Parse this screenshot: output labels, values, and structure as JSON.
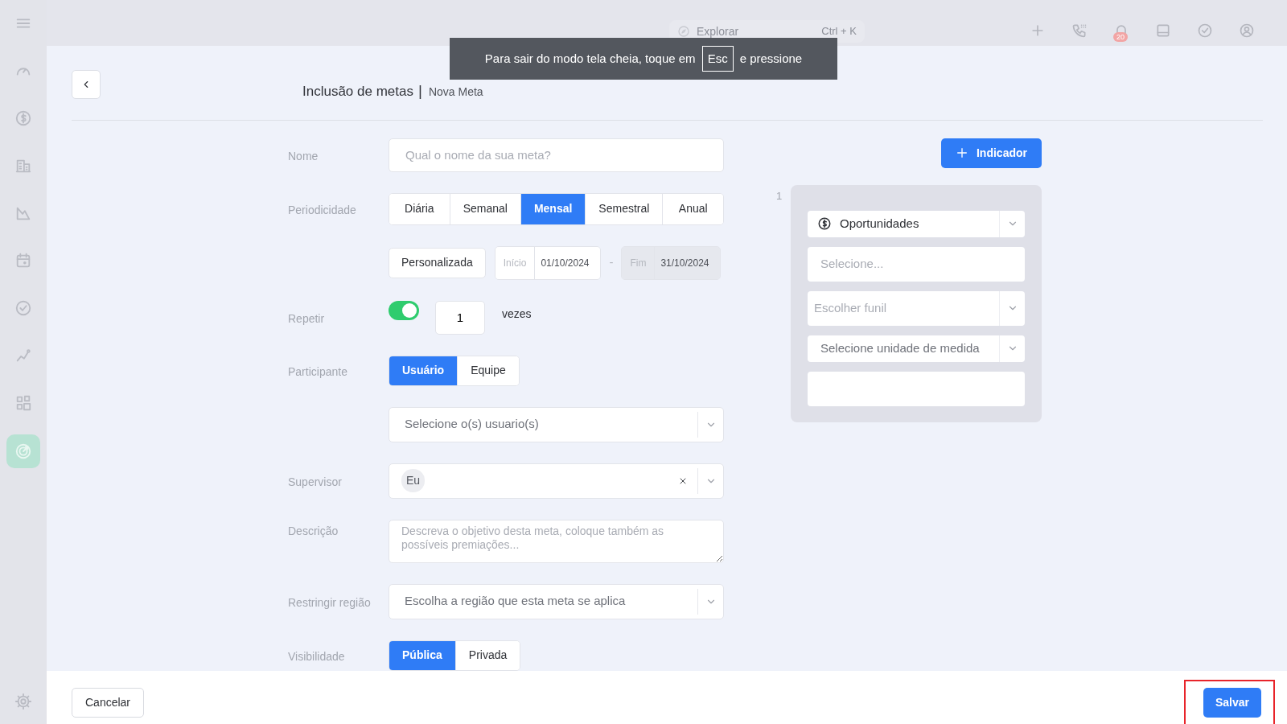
{
  "sidebar": {
    "items": [
      {
        "kind": "menu",
        "selected": false
      },
      {
        "kind": "gauge",
        "selected": false
      },
      {
        "kind": "dollar",
        "selected": false
      },
      {
        "kind": "building",
        "selected": false
      },
      {
        "kind": "chart",
        "selected": false
      },
      {
        "kind": "calendar",
        "selected": false
      },
      {
        "kind": "check",
        "selected": false
      },
      {
        "kind": "trend",
        "selected": false
      },
      {
        "kind": "widgets",
        "selected": false
      },
      {
        "kind": "target",
        "selected": true
      },
      {
        "kind": "settings",
        "selected": false
      }
    ]
  },
  "topbar": {
    "search": {
      "placeholder": "Explorar",
      "shortcut": "Ctrl + K"
    },
    "actions": [
      {
        "kind": "add"
      },
      {
        "kind": "phone"
      },
      {
        "kind": "bell",
        "badge": "20"
      },
      {
        "kind": "inbox"
      },
      {
        "kind": "task"
      },
      {
        "kind": "account"
      }
    ]
  },
  "fullscreen_notice": {
    "before": "Para sair do modo tela cheia, toque em",
    "key": "Esc",
    "after": "e pressione"
  },
  "header": {
    "title": "Inclusão de metas",
    "separator": "|",
    "subtitle": "Nova Meta"
  },
  "form": {
    "name": {
      "label": "Nome",
      "placeholder": "Qual o nome da sua meta?"
    },
    "periodicity": {
      "label": "Periodicidade",
      "options": [
        {
          "label": "Diária",
          "selected": false
        },
        {
          "label": "Semanal",
          "selected": false
        },
        {
          "label": "Mensal",
          "selected": true
        },
        {
          "label": "Semestral",
          "selected": false
        },
        {
          "label": "Anual",
          "selected": false
        }
      ],
      "custom": {
        "label": "Personalizada",
        "selected": false
      },
      "start": {
        "label": "Início",
        "value": "01/10/2024",
        "disabled": false
      },
      "range_separator": "-",
      "end": {
        "label": "Fim",
        "value": "31/10/2024",
        "disabled": true
      }
    },
    "repeat": {
      "label": "Repetir",
      "on": true,
      "count": "1",
      "unit": "vezes"
    },
    "participant": {
      "label": "Participante",
      "options": [
        {
          "label": "Usuário",
          "selected": true
        },
        {
          "label": "Equipe",
          "selected": false
        }
      ],
      "users": {
        "placeholder": "Selecione o(s) usuario(s)"
      }
    },
    "supervisor": {
      "label": "Supervisor",
      "chips": [
        "Eu"
      ]
    },
    "description": {
      "label": "Descrição",
      "placeholder": "Descreva o objetivo desta meta, coloque também as possíveis premiações..."
    },
    "region": {
      "label": "Restringir região",
      "placeholder": "Escolha a região que esta meta se aplica"
    },
    "visibility": {
      "label": "Visibilidade",
      "options": [
        {
          "label": "Pública",
          "selected": true
        },
        {
          "label": "Privada",
          "selected": false
        }
      ]
    }
  },
  "indicators": {
    "add_button": "Indicador",
    "items": [
      {
        "number": "1",
        "type": "Oportunidades",
        "select_placeholder": "Selecione...",
        "funnel_placeholder": "Escolher funil",
        "unit_placeholder": "Selecione unidade de medida"
      }
    ]
  },
  "footer": {
    "cancel": "Cancelar",
    "save": "Salvar",
    "save_highlighted": true
  }
}
